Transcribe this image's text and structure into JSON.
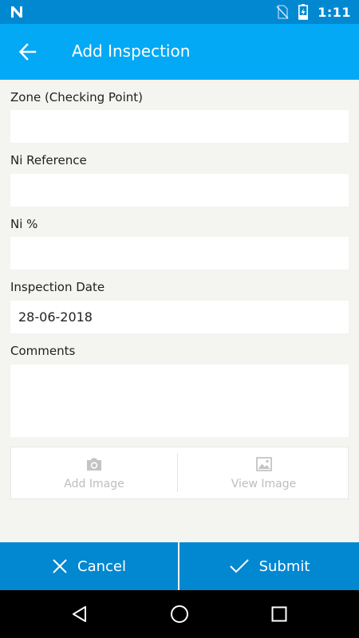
{
  "status_bar": {
    "time": "1:11",
    "icons": [
      "notification-n-icon",
      "no-sim-icon",
      "battery-charging-icon"
    ]
  },
  "app_bar": {
    "title": "Add Inspection",
    "back_icon": "arrow-left-icon"
  },
  "form": {
    "zone": {
      "label": "Zone (Checking Point)",
      "value": ""
    },
    "ni_reference": {
      "label": "Ni Reference",
      "value": ""
    },
    "ni_percent": {
      "label": "Ni %",
      "value": ""
    },
    "inspection_date": {
      "label": "Inspection Date",
      "value": "28-06-2018"
    },
    "comments": {
      "label": "Comments",
      "value": ""
    }
  },
  "image_actions": {
    "add_label": "Add Image",
    "add_icon": "camera-icon",
    "view_label": "View Image",
    "view_icon": "image-icon"
  },
  "actions": {
    "cancel_label": "Cancel",
    "cancel_icon": "close-icon",
    "submit_label": "Submit",
    "submit_icon": "check-icon"
  },
  "nav": [
    "back-triangle-icon",
    "home-circle-icon",
    "recents-square-icon"
  ],
  "colors": {
    "status_bar": "#0288d1",
    "app_bar": "#03a9f4",
    "action_bar": "#0288d1",
    "background": "#f4f4f0"
  }
}
